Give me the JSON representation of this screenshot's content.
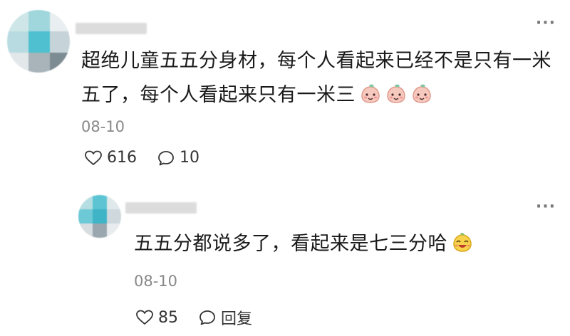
{
  "comments": [
    {
      "text": "超绝儿童五五分身材，每个人看起来已经不是只有一米五了，每个人看起来只有一米三",
      "emoji_icons": [
        "peach-face-icon",
        "peach-face-icon",
        "peach-face-icon"
      ],
      "date": "08-10",
      "likes": "616",
      "replies": "10"
    },
    {
      "text": "五五分都说多了，看起来是七三分哈",
      "emoji_icons": [
        "laughing-face-icon"
      ],
      "date": "08-10",
      "likes": "85",
      "reply_label": "回复"
    }
  ],
  "colors": {
    "text": "#1a1a1a",
    "meta": "#888888",
    "icon": "#333333"
  }
}
